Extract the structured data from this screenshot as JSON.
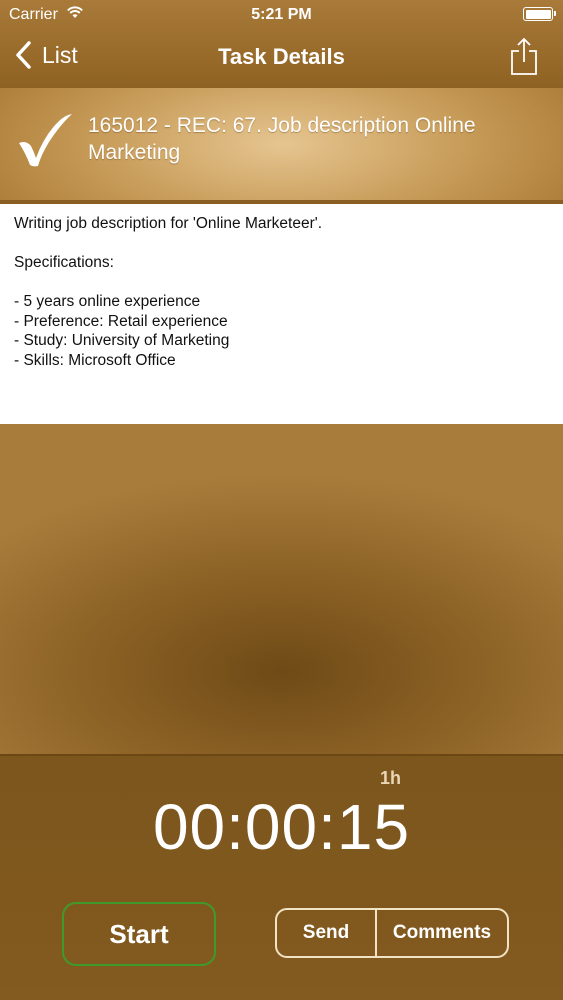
{
  "status_bar": {
    "carrier": "Carrier",
    "time": "5:21 PM"
  },
  "nav": {
    "back_label": "List",
    "title": "Task Details"
  },
  "task": {
    "title": "165012 - REC: 67. Job description Online Marketing",
    "description_lines": [
      "Writing job description for 'Online Marketeer'.",
      "",
      "Specifications:",
      "",
      "- 5 years online experience",
      "- Preference: Retail experience",
      "- Study: University of Marketing",
      "- Skills: Microsoft Office"
    ]
  },
  "timer": {
    "budget": "1h",
    "elapsed": "00:00:15"
  },
  "actions": {
    "start_label": "Start",
    "send_label": "Send",
    "comments_label": "Comments"
  },
  "colors": {
    "accent_green": "#3f9a2b",
    "gold": "#c79b58"
  }
}
